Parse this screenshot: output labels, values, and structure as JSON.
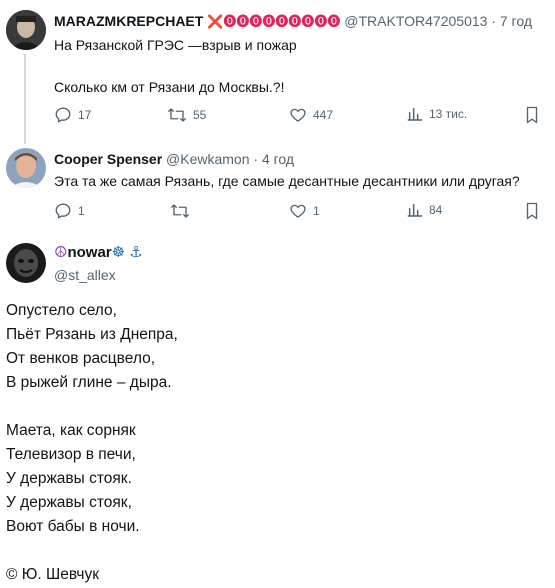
{
  "tweets": [
    {
      "name": "MARAZMKREPCHAET",
      "badges": "❌⓿⓿⓿⓿⓿⓿⓿⓿⓿",
      "handle": "@TRAKTOR47205013",
      "time": "· 7 год",
      "line1": "На Рязанской ГРЭС —взрыв и пожар",
      "line2": "Сколько км от Рязани до Москвы.?!",
      "stats": {
        "replies": "17",
        "retweets": "55",
        "likes": "447",
        "views": "13 тис."
      }
    },
    {
      "name": "Cooper Spenser",
      "handle": "@Kewkamon",
      "time": "· 4 год",
      "line1": "Эта та же самая Рязань, где самые десантные десантники или другая?",
      "stats": {
        "replies": "1",
        "retweets": "",
        "likes": "1",
        "views": "84"
      }
    }
  ],
  "author": {
    "name": "nowar",
    "prefix_icon": "☮",
    "suffix_icons": "☸ ⚓",
    "handle": "@st_allex"
  },
  "poem": {
    "lines": [
      "Опустело село,",
      "Пьёт Рязань из Днепра,",
      "От венков расцвело,",
      "В рыжей глине – дыра.",
      "",
      "Маета, как сорняк",
      "Телевизор в печи,",
      "У державы стояк.",
      "У державы стояк,",
      "Воют бабы в ночи."
    ],
    "signature": "© Ю. Шевчук"
  },
  "colors": {
    "text": "#0f1419",
    "meta": "#536471",
    "badge_red": "#e0245e",
    "icon_purple": "#8e44ad",
    "anchor_blue": "#1d6fb8"
  }
}
